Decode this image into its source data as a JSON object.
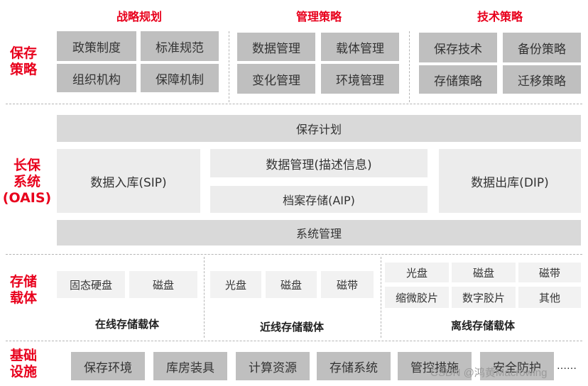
{
  "sections": {
    "strategy": "保存策略",
    "oais": "长保系统(OAIS)",
    "storage": "存储载体",
    "infra": "基础设施"
  },
  "strategy": {
    "headers": [
      "战略规划",
      "管理策略",
      "技术策略"
    ],
    "planning": [
      "政策制度",
      "标准规范",
      "组织机构",
      "保障机制"
    ],
    "management": [
      "数据管理",
      "载体管理",
      "变化管理",
      "环境管理"
    ],
    "technical": [
      "保存技术",
      "备份策略",
      "存储策略",
      "迁移策略"
    ]
  },
  "oais": {
    "plan": "保存计划",
    "ingest": "数据入库(SIP)",
    "data_mgmt": "数据管理(描述信息)",
    "archival": "档案存储(AIP)",
    "access": "数据出库(DIP)",
    "admin": "系统管理"
  },
  "storage": {
    "online": {
      "items": [
        "固态硬盘",
        "磁盘"
      ],
      "label": "在线存储载体"
    },
    "nearline": {
      "items": [
        "光盘",
        "磁盘",
        "磁带"
      ],
      "label": "近线存储载体"
    },
    "offline": {
      "items": [
        "光盘",
        "磁盘",
        "磁带",
        "缩微胶片",
        "数字胶片",
        "其他"
      ],
      "label": "离线存储载体"
    }
  },
  "infra": {
    "items": [
      "保存环境",
      "库房装具",
      "计算资源",
      "存储系统",
      "管控措施",
      "安全防护"
    ],
    "ellipsis": "……"
  },
  "watermark": "CSDN @鸿黄Macrowing"
}
